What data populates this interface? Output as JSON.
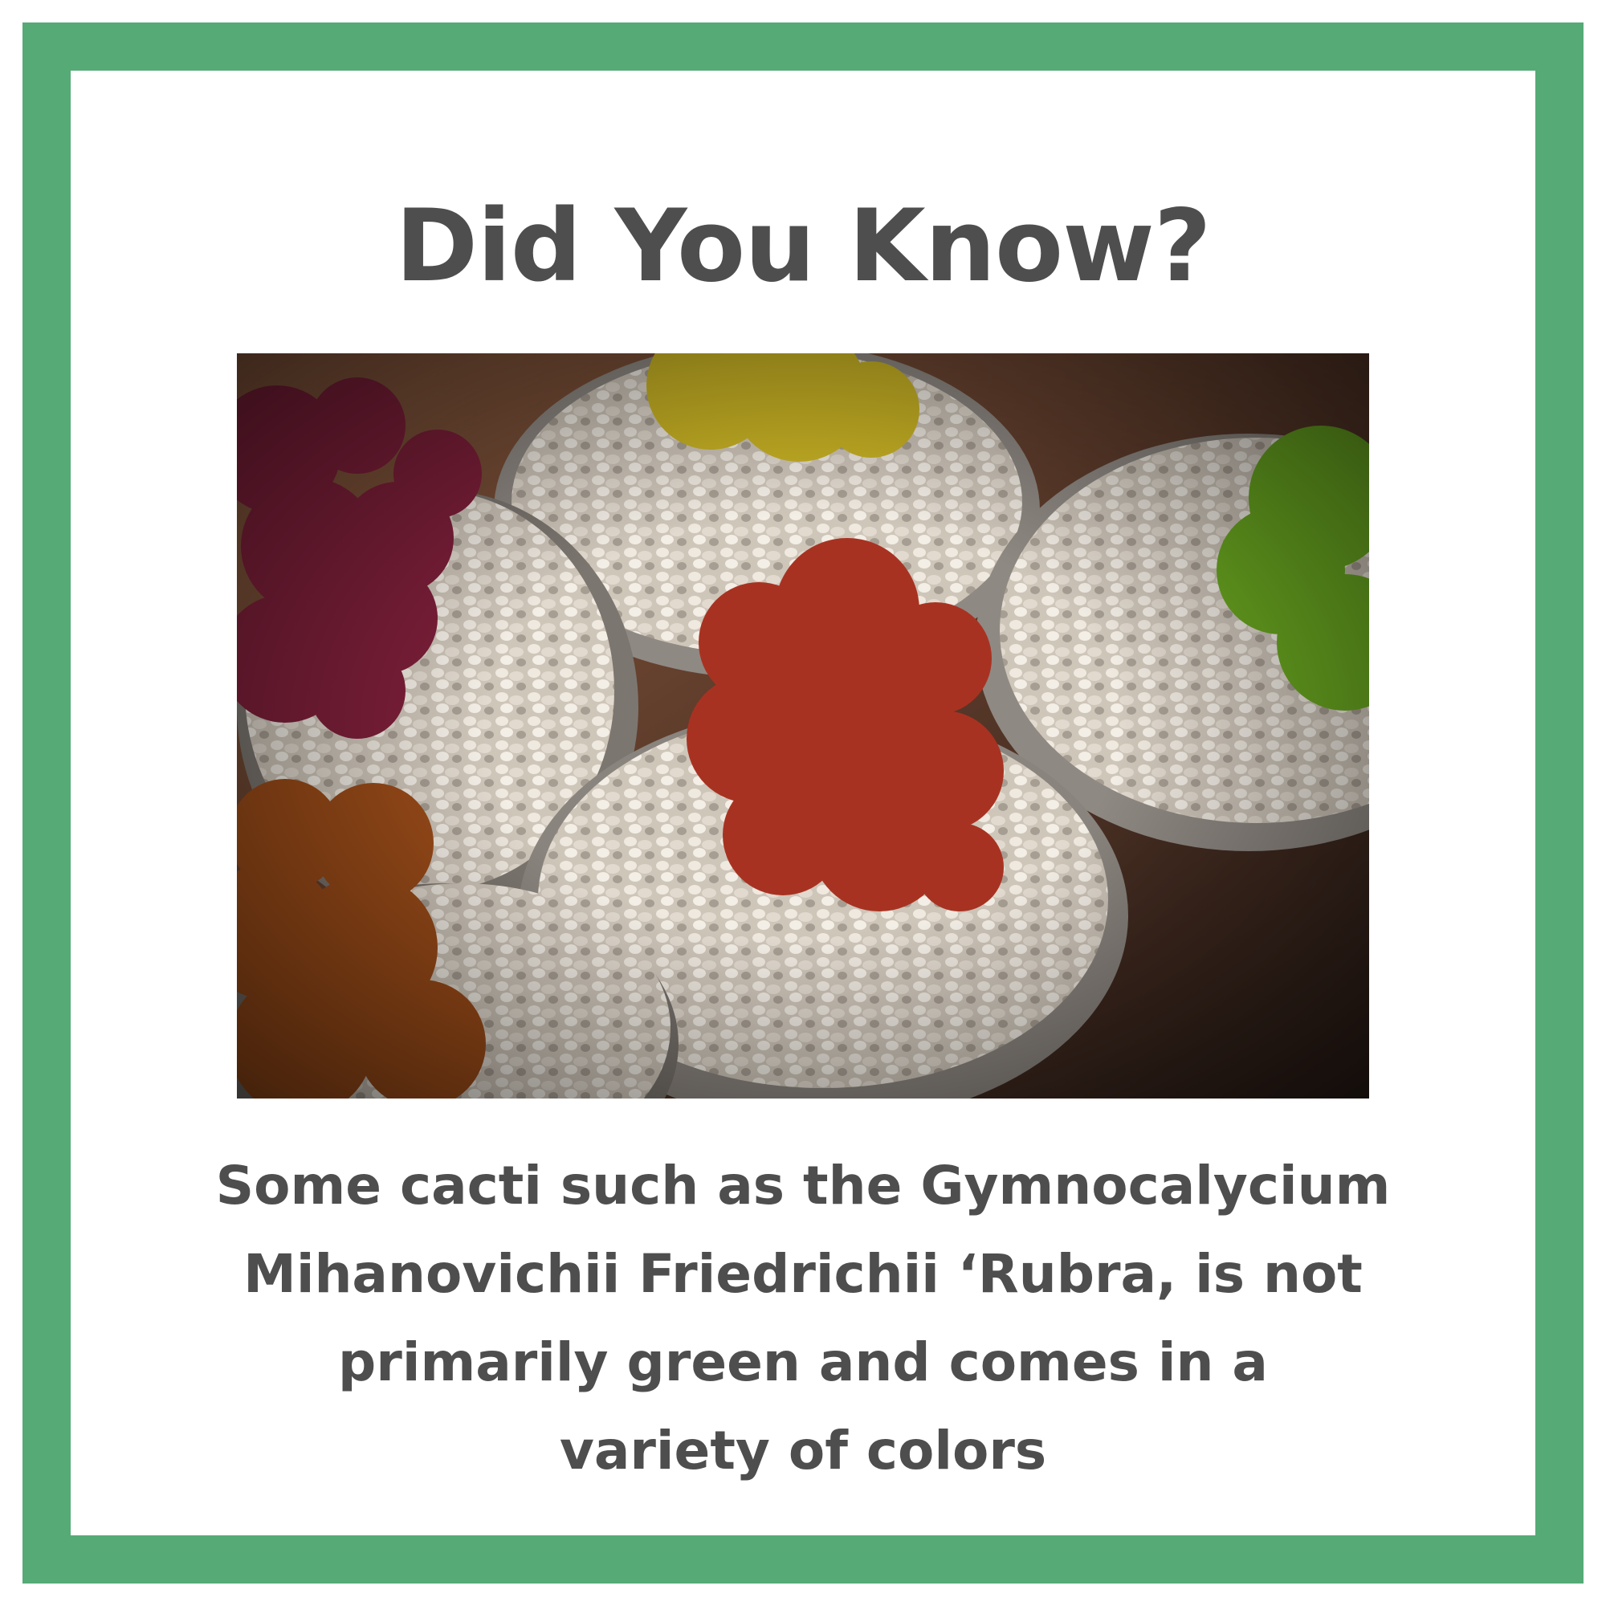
{
  "title": "Did You Know?",
  "caption": {
    "lines": [
      "Some cacti such as the Gymnocalycium",
      "Mihanovichii Friedrichii ‘Rubra, is not",
      "primarily green and comes in a",
      "variety of colors"
    ]
  },
  "colors": {
    "border": "#55aa76",
    "text": "#4e4e4e",
    "background": "#ffffff"
  }
}
